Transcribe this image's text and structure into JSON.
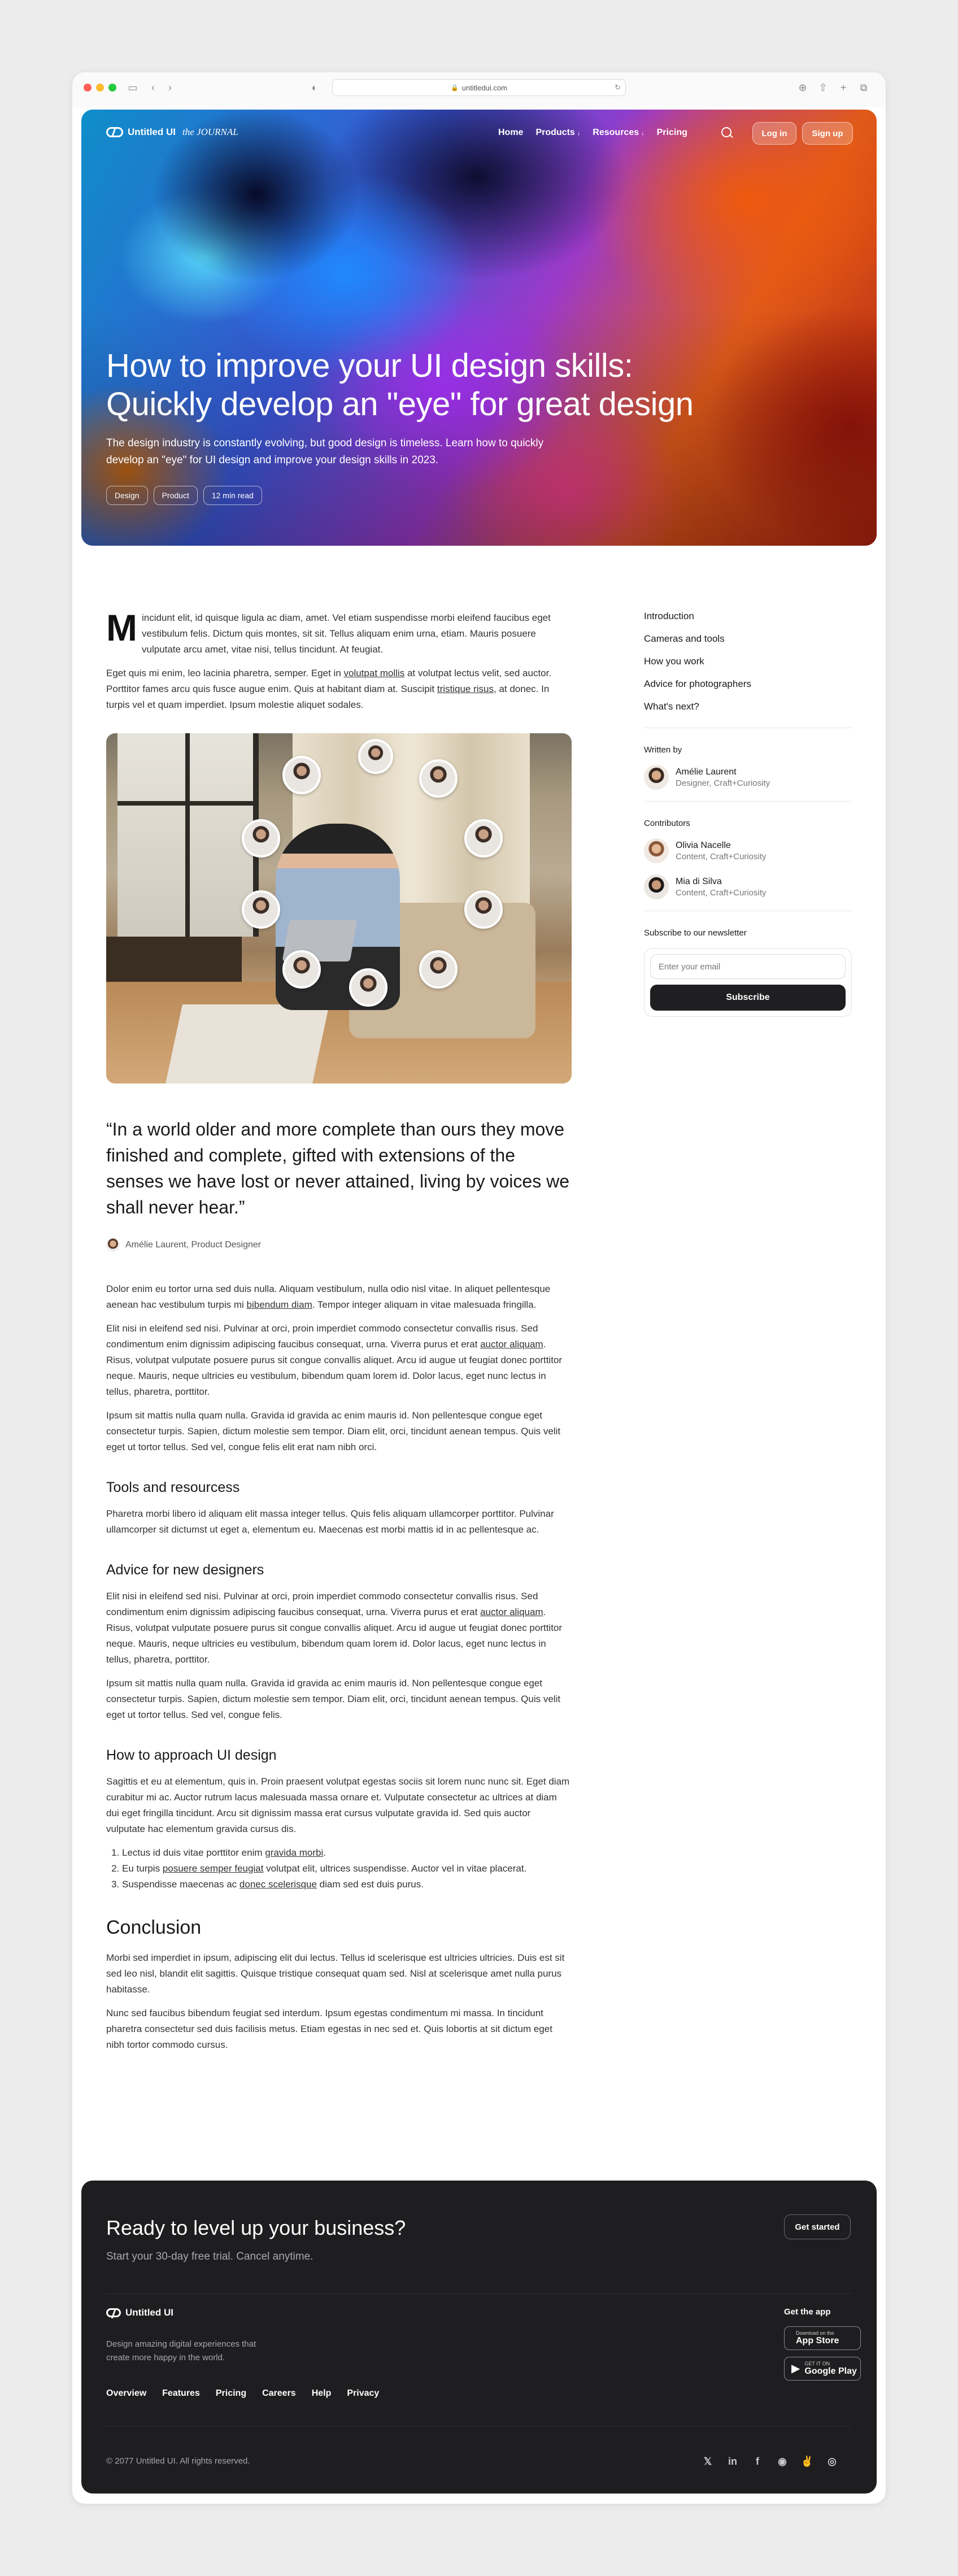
{
  "browser": {
    "url": "untitledui.com"
  },
  "header": {
    "logo": "Untitled UI",
    "logo_sub": "the JOURNAL",
    "nav": [
      {
        "label": "Home"
      },
      {
        "label": "Products",
        "chevron": "↓"
      },
      {
        "label": "Resources",
        "chevron": "↓"
      },
      {
        "label": "Pricing"
      }
    ],
    "login": "Log in",
    "signup": "Sign up"
  },
  "hero": {
    "title": "How to improve your UI design skills: Quickly develop an \"eye\" for great design",
    "subtitle": "The design industry is constantly evolving, but good design is timeless. Learn how to quickly develop an \"eye\" for UI design and improve your design skills in 2023.",
    "tags": [
      "Design",
      "Product",
      "12 min read"
    ]
  },
  "article": {
    "dropcap": "M",
    "p1": "incidunt elit, id quisque ligula ac diam, amet. Vel etiam suspendisse morbi eleifend faucibus eget vestibulum felis. Dictum quis montes, sit sit. Tellus aliquam enim urna, etiam. Mauris posuere vulputate arcu amet, vitae nisi, tellus tincidunt. At feugiat.",
    "p2": {
      "a": "Eget quis mi enim, leo lacinia pharetra, semper. Eget in ",
      "link1": "volutpat mollis",
      "b": " at volutpat lectus velit, sed auctor. Porttitor fames arcu quis fusce augue enim. Quis at habitant diam at. Suscipit ",
      "link2": "tristique risus",
      "c": ", at donec. In turpis vel et quam imperdiet. Ipsum molestie aliquet sodales."
    },
    "quote": "“In a world older and more complete than ours they move finished and complete, gifted with extensions of the senses we have lost or never attained, living by voices we shall never hear.”",
    "quote_author": "Amélie Laurent, Product Designer",
    "p3": {
      "a": "Dolor enim eu tortor urna sed duis nulla. Aliquam vestibulum, nulla odio nisl vitae. In aliquet pellentesque aenean hac vestibulum turpis mi ",
      "link": "bibendum diam",
      "b": ". Tempor integer aliquam in vitae malesuada fringilla."
    },
    "p4": {
      "a": "Elit nisi in eleifend sed nisi. Pulvinar at orci, proin imperdiet commodo consectetur convallis risus. Sed condimentum enim dignissim adipiscing faucibus consequat, urna. Viverra purus et erat ",
      "link": "auctor aliquam",
      "b": ". Risus, volutpat vulputate posuere purus sit congue convallis aliquet. Arcu id augue ut feugiat donec porttitor neque. Mauris, neque ultricies eu vestibulum, bibendum quam lorem id. Dolor lacus, eget nunc lectus in tellus, pharetra, porttitor."
    },
    "p5": "Ipsum sit mattis nulla quam nulla. Gravida id gravida ac enim mauris id. Non pellentesque congue eget consectetur turpis. Sapien, dictum molestie sem tempor. Diam elit, orci, tincidunt aenean tempus. Quis velit eget ut tortor tellus. Sed vel, congue felis elit erat nam nibh orci.",
    "h_tools": "Tools and resourcess",
    "p6": "Pharetra morbi libero id aliquam elit massa integer tellus. Quis felis aliquam ullamcorper porttitor. Pulvinar ullamcorper sit dictumst ut eget a, elementum eu. Maecenas est morbi mattis id in ac pellentesque ac.",
    "h_advice": "Advice for new designers",
    "p7": {
      "a": "Elit nisi in eleifend sed nisi. Pulvinar at orci, proin imperdiet commodo consectetur convallis risus. Sed condimentum enim dignissim adipiscing faucibus consequat, urna. Viverra purus et erat ",
      "link": "auctor aliquam",
      "b": ". Risus, volutpat vulputate posuere purus sit congue convallis aliquet. Arcu id augue ut feugiat donec porttitor neque. Mauris, neque ultricies eu vestibulum, bibendum quam lorem id. Dolor lacus, eget nunc lectus in tellus, pharetra, porttitor."
    },
    "p8": "Ipsum sit mattis nulla quam nulla. Gravida id gravida ac enim mauris id. Non pellentesque congue eget consectetur turpis. Sapien, dictum molestie sem tempor. Diam elit, orci, tincidunt aenean tempus. Quis velit eget ut tortor tellus. Sed vel, congue felis.",
    "h_approach": "How to approach UI design",
    "p9": "Sagittis et eu at elementum, quis in. Proin praesent volutpat egestas sociis sit lorem nunc nunc sit. Eget diam curabitur mi ac. Auctor rutrum lacus malesuada massa ornare et. Vulputate consectetur ac ultrices at diam dui eget fringilla tincidunt. Arcu sit dignissim massa erat cursus vulputate gravida id. Sed quis auctor vulputate hac elementum gravida cursus dis.",
    "list": [
      {
        "a": "Lectus id duis vitae porttitor enim ",
        "link": "gravida morbi",
        "b": "."
      },
      {
        "a": "Eu turpis ",
        "link": "posuere semper feugiat",
        "b": " volutpat elit, ultrices suspendisse. Auctor vel in vitae placerat."
      },
      {
        "a": "Suspendisse maecenas ac ",
        "link": "donec scelerisque",
        "b": " diam sed est duis purus."
      }
    ],
    "h_conclusion": "Conclusion",
    "p10": "Morbi sed imperdiet in ipsum, adipiscing elit dui lectus. Tellus id scelerisque est ultricies ultricies. Duis est sit sed leo nisl, blandit elit sagittis. Quisque tristique consequat quam sed. Nisl at scelerisque amet nulla purus habitasse.",
    "p11": "Nunc sed faucibus bibendum feugiat sed interdum. Ipsum egestas condimentum mi massa. In tincidunt pharetra consectetur sed duis facilisis metus. Etiam egestas in nec sed et. Quis lobortis at sit dictum eget nibh tortor commodo cursus."
  },
  "sidebar": {
    "toc": [
      "Introduction",
      "Cameras and tools",
      "How you work",
      "Advice for photographers",
      "What's next?"
    ],
    "written_by_label": "Written by",
    "author": {
      "name": "Amélie Laurent",
      "role": "Designer, Craft+Curiosity"
    },
    "contributors_label": "Contributors",
    "contributors": [
      {
        "name": "Olivia Nacelle",
        "role": "Content, Craft+Curiosity"
      },
      {
        "name": "Mia di Silva",
        "role": "Content, Craft+Curiosity"
      }
    ],
    "newsletter_label": "Subscribe to our newsletter",
    "email_placeholder": "Enter your email",
    "subscribe": "Subscribe"
  },
  "footer": {
    "cta_title": "Ready to level up your business?",
    "cta_sub": "Start your 30-day free trial. Cancel anytime.",
    "cta_button": "Get started",
    "logo": "Untitled UI",
    "desc": "Design amazing digital experiences that create more happy in the world.",
    "links": [
      "Overview",
      "Features",
      "Pricing",
      "Careers",
      "Help",
      "Privacy"
    ],
    "get_app": "Get the app",
    "app_store": {
      "small": "Download on the",
      "big": "App Store"
    },
    "google_play": {
      "small": "GET IT ON",
      "big": "Google Play"
    },
    "copyright": "© 2077 Untitled UI. All rights reserved.",
    "socials": [
      "x-icon",
      "linkedin-icon",
      "facebook-icon",
      "github-icon",
      "angellist-icon",
      "dribbble-icon"
    ]
  }
}
